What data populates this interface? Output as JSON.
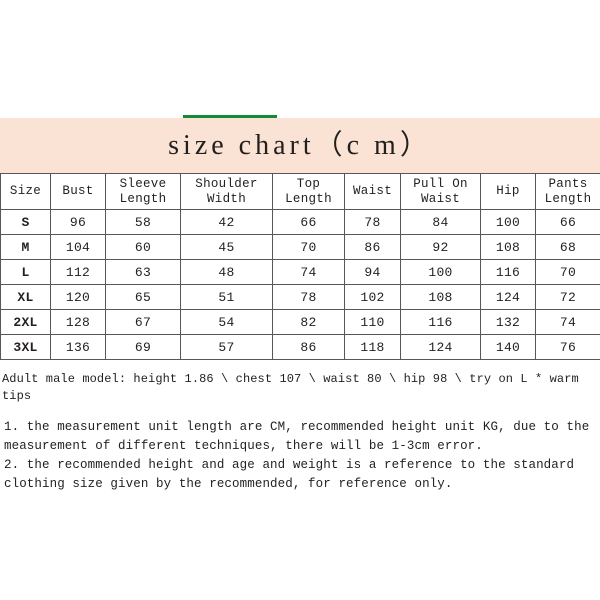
{
  "colors": {
    "accent_green": "#138a36",
    "title_band": "#fae2d5",
    "border": "#595552",
    "text": "#231f1d",
    "background": "#ffffff"
  },
  "header": {
    "title": "size chart（c m）"
  },
  "table": {
    "columns": [
      "Size",
      "Bust",
      "Sleeve Length",
      "Shoulder Width",
      "Top Length",
      "Waist",
      "Pull On Waist",
      "Hip",
      "Pants Length"
    ],
    "rows": [
      {
        "size": "S",
        "bust": "96",
        "sleeve_length": "58",
        "shoulder_width": "42",
        "top_length": "66",
        "waist": "78",
        "pull_on_waist": "84",
        "hip": "100",
        "pants_length": "66"
      },
      {
        "size": "M",
        "bust": "104",
        "sleeve_length": "60",
        "shoulder_width": "45",
        "top_length": "70",
        "waist": "86",
        "pull_on_waist": "92",
        "hip": "108",
        "pants_length": "68"
      },
      {
        "size": "L",
        "bust": "112",
        "sleeve_length": "63",
        "shoulder_width": "48",
        "top_length": "74",
        "waist": "94",
        "pull_on_waist": "100",
        "hip": "116",
        "pants_length": "70"
      },
      {
        "size": "XL",
        "bust": "120",
        "sleeve_length": "65",
        "shoulder_width": "51",
        "top_length": "78",
        "waist": "102",
        "pull_on_waist": "108",
        "hip": "124",
        "pants_length": "72"
      },
      {
        "size": "2XL",
        "bust": "128",
        "sleeve_length": "67",
        "shoulder_width": "54",
        "top_length": "82",
        "waist": "110",
        "pull_on_waist": "116",
        "hip": "132",
        "pants_length": "74"
      },
      {
        "size": "3XL",
        "bust": "136",
        "sleeve_length": "69",
        "shoulder_width": "57",
        "top_length": "86",
        "waist": "118",
        "pull_on_waist": "124",
        "hip": "140",
        "pants_length": "76"
      }
    ]
  },
  "model_note": "Adult male model: height 1.86 \\ chest 107 \\ waist 80 \\ hip 98 \\ try on L * warm tips",
  "notes": {
    "note_1": "1. the measurement unit length are CM, recommended height unit KG, due to the measurement of different techniques, there will be 1-3cm error.",
    "note_2": "2. the recommended height and age and weight is a reference to the standard clothing size given by the recommended, for reference only."
  }
}
